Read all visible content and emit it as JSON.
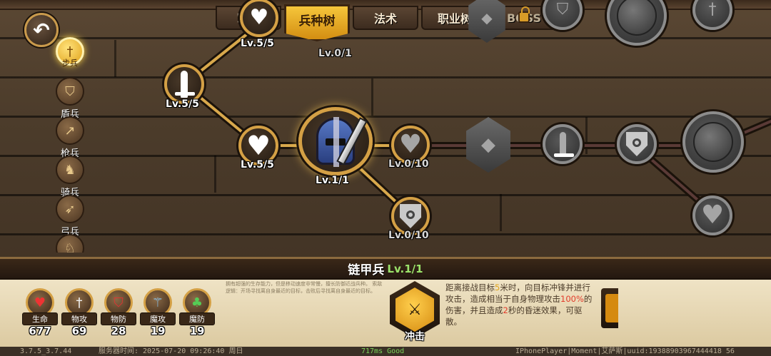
{
  "tabs": [
    {
      "label": "军团"
    },
    {
      "label": "兵种树"
    },
    {
      "label": "法术"
    },
    {
      "label": "职业树"
    },
    {
      "label": "BOSS"
    }
  ],
  "sidebar": {
    "back_icon": "back-arrow-icon",
    "items": [
      {
        "label": "步兵",
        "icon": "sword-icon"
      },
      {
        "label": "盾兵",
        "icon": "shield-icon"
      },
      {
        "label": "枪兵",
        "icon": "spear-icon"
      },
      {
        "label": "骑兵",
        "icon": "horse-icon"
      },
      {
        "label": "弓兵",
        "icon": "bow-icon"
      }
    ]
  },
  "tree": {
    "nodes": [
      {
        "id": "top-heart",
        "level": "Lv.5/5"
      },
      {
        "id": "top-center",
        "level": "Lv.0/1"
      },
      {
        "id": "sword",
        "level": "Lv.5/5"
      },
      {
        "id": "heart",
        "level": "Lv.5/5"
      },
      {
        "id": "knight",
        "level": "Lv.1/1"
      },
      {
        "id": "heart-locked",
        "level": "Lv.0/10"
      },
      {
        "id": "shield-locked",
        "level": "Lv.0/10"
      }
    ]
  },
  "panel": {
    "unit_name": "链甲兵",
    "unit_level": "Lv.1/1",
    "small_desc": "拥有超强的生存能力，但是移动速度非常慢，擅长防御近战兵种。 索敌逻辑：开场寻找离自身最近的目标，击败后寻找离自身最近的目标。",
    "stats": [
      {
        "label": "生命",
        "value": "677",
        "icon": "heart-icon"
      },
      {
        "label": "物攻",
        "value": "69",
        "icon": "sword-icon"
      },
      {
        "label": "物防",
        "value": "28",
        "icon": "shield-icon"
      },
      {
        "label": "魔攻",
        "value": "19",
        "icon": "staff-icon"
      },
      {
        "label": "魔防",
        "value": "19",
        "icon": "clover-icon"
      }
    ],
    "skill": {
      "name": "冲击",
      "desc_1": "距离接战目标",
      "desc_num1": "5",
      "desc_2": "米时，向目标冲锋并进行攻击，造成相当于自身物理攻击",
      "desc_pct": "100%",
      "desc_3": "的伤害，并且造成",
      "desc_num2": "2",
      "desc_4": "秒的昏迷效果，可驱散。"
    }
  },
  "footer": {
    "version": "3.7.5_3.7.44",
    "server_time": "服务器时间:  2025-07-20  09:26:40  周日",
    "ping": "717ms Good",
    "player": "IPhonePlayer|Moment|艾萨斯|uuid:19388903967444418 56"
  }
}
